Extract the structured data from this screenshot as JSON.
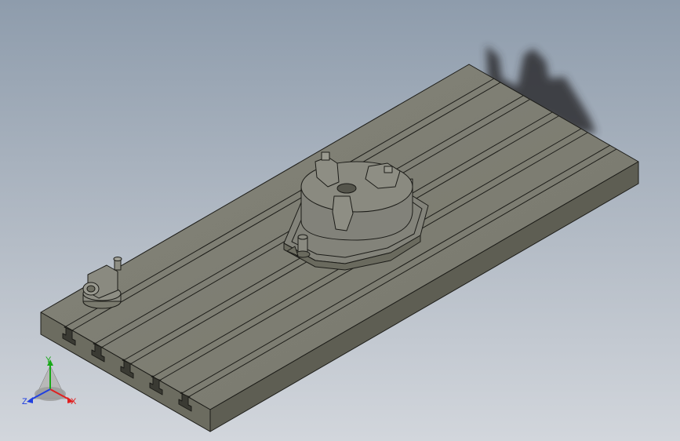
{
  "viewport": {
    "background_top": "#8e9cac",
    "background_bottom": "#d2d6dc",
    "model_color": "#7d7d6f",
    "edge_color": "#1c1c18"
  },
  "triad": {
    "x_label": "X",
    "y_label": "Y",
    "z_label": "Z",
    "x_color": "#e02020",
    "y_color": "#18a818",
    "z_color": "#2040e0"
  }
}
